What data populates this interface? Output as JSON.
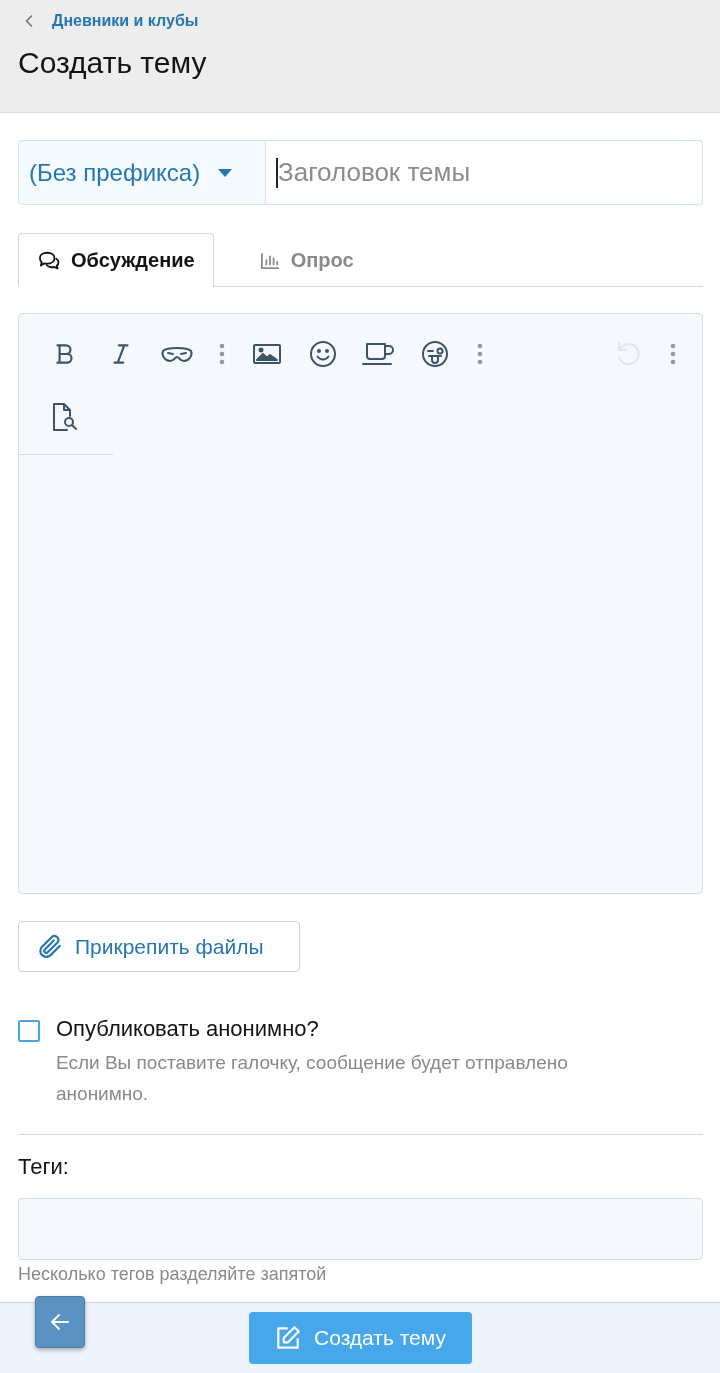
{
  "breadcrumb": {
    "label": "Дневники и клубы"
  },
  "page_title": "Создать тему",
  "prefix_select": {
    "value": "(Без префикса)"
  },
  "title_field": {
    "placeholder": "Заголовок темы"
  },
  "tabs": [
    {
      "label": "Обсуждение",
      "selected": true
    },
    {
      "label": "Опрос",
      "selected": false
    }
  ],
  "toolbar_rows": [
    {
      "left": [
        {
          "kind": "tool",
          "disabled": false
        },
        {
          "kind": "tool",
          "disabled": false
        },
        {
          "kind": "tool",
          "disabled": false
        },
        {
          "kind": "more",
          "disabled": false
        },
        {
          "kind": "tool",
          "disabled": false
        },
        {
          "kind": "tool",
          "disabled": false
        },
        {
          "kind": "tool",
          "disabled": false
        },
        {
          "kind": "tool",
          "disabled": false
        },
        {
          "kind": "more",
          "disabled": false
        }
      ],
      "right": [
        {
          "kind": "tool",
          "disabled": true
        },
        {
          "kind": "more",
          "disabled": false
        }
      ]
    },
    {
      "left": [
        {
          "kind": "tool",
          "disabled": false
        }
      ]
    }
  ],
  "attach_button": {
    "label": "Прикрепить файлы"
  },
  "anonymous": {
    "label": "Опубликовать анонимно?",
    "checked": false,
    "hint": "Если Вы поставите галочку, сообщение будет отправлено анонимно."
  },
  "tags": {
    "label": "Теги:",
    "hint": "Несколько тегов разделяйте запятой"
  },
  "submit_button": {
    "label": "Создать тему"
  }
}
